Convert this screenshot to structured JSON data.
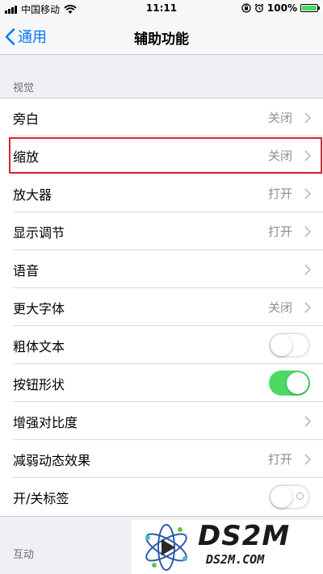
{
  "status_bar": {
    "carrier": "中国移动",
    "time": "11:11",
    "battery_percent": "100%",
    "battery_level": 1.0
  },
  "nav": {
    "back_label": "通用",
    "title": "辅助功能"
  },
  "sections": {
    "vision_header": "视觉",
    "interaction_header": "互动"
  },
  "vision_rows": [
    {
      "label": "旁白",
      "value": "关闭"
    },
    {
      "label": "缩放",
      "value": "关闭"
    },
    {
      "label": "放大器",
      "value": "打开"
    },
    {
      "label": "显示调节",
      "value": "打开"
    },
    {
      "label": "语音",
      "value": ""
    },
    {
      "label": "更大字体",
      "value": "关闭"
    },
    {
      "label": "粗体文本",
      "toggle": "off"
    },
    {
      "label": "按钮形状",
      "toggle": "on"
    },
    {
      "label": "增强对比度",
      "value": ""
    },
    {
      "label": "减弱动态效果",
      "value": "打开"
    },
    {
      "label": "开/关标签",
      "toggle": "off"
    }
  ],
  "watermark": {
    "main": "DS2M",
    "sub": "DS2M.COM"
  },
  "colors": {
    "accent": "#007aff",
    "toggle_on": "#4cd964",
    "highlight": "#d9262f"
  }
}
